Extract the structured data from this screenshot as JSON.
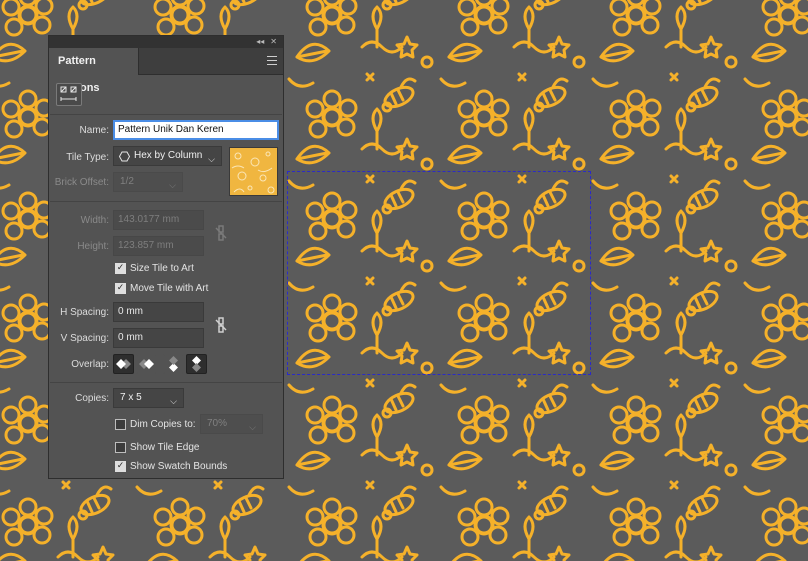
{
  "panel": {
    "collapse_glyph": "◂◂",
    "close_glyph": "✕",
    "tab_title": "Pattern Options",
    "menu_icon": "hamburger-menu-icon",
    "tile_tool_icon": "pattern-tile-tool-icon",
    "name_label": "Name:",
    "name_value": "Pattern Unik Dan Keren",
    "tile_type_label": "Tile Type:",
    "tile_type_value": "Hex by Column",
    "tile_type_icon": "hexagon-icon",
    "brick_offset_label": "Brick Offset:",
    "brick_offset_value": "1/2",
    "width_label": "Width:",
    "width_value": "143.0177 mm",
    "height_label": "Height:",
    "height_value": "123.857 mm",
    "size_tile_label": "Size Tile to Art",
    "size_tile_checked": true,
    "move_tile_label": "Move Tile with Art",
    "move_tile_checked": true,
    "h_spacing_label": "H Spacing:",
    "h_spacing_value": "0 mm",
    "v_spacing_label": "V Spacing:",
    "v_spacing_value": "0 mm",
    "overlap_label": "Overlap:",
    "copies_label": "Copies:",
    "copies_value": "7 x 5",
    "dim_copies_label": "Dim Copies to:",
    "dim_copies_checked": false,
    "dim_copies_value": "70%",
    "show_tile_edge_label": "Show Tile Edge",
    "show_tile_edge_checked": false,
    "show_swatch_bounds_label": "Show Swatch Bounds",
    "show_swatch_bounds_checked": true
  },
  "colors": {
    "pattern_line": "#f5b12a",
    "pattern_background": "#5b5b5b",
    "panel_background": "#535353",
    "selection_bounds": "#2a2ac8"
  },
  "check_glyph": "✓"
}
